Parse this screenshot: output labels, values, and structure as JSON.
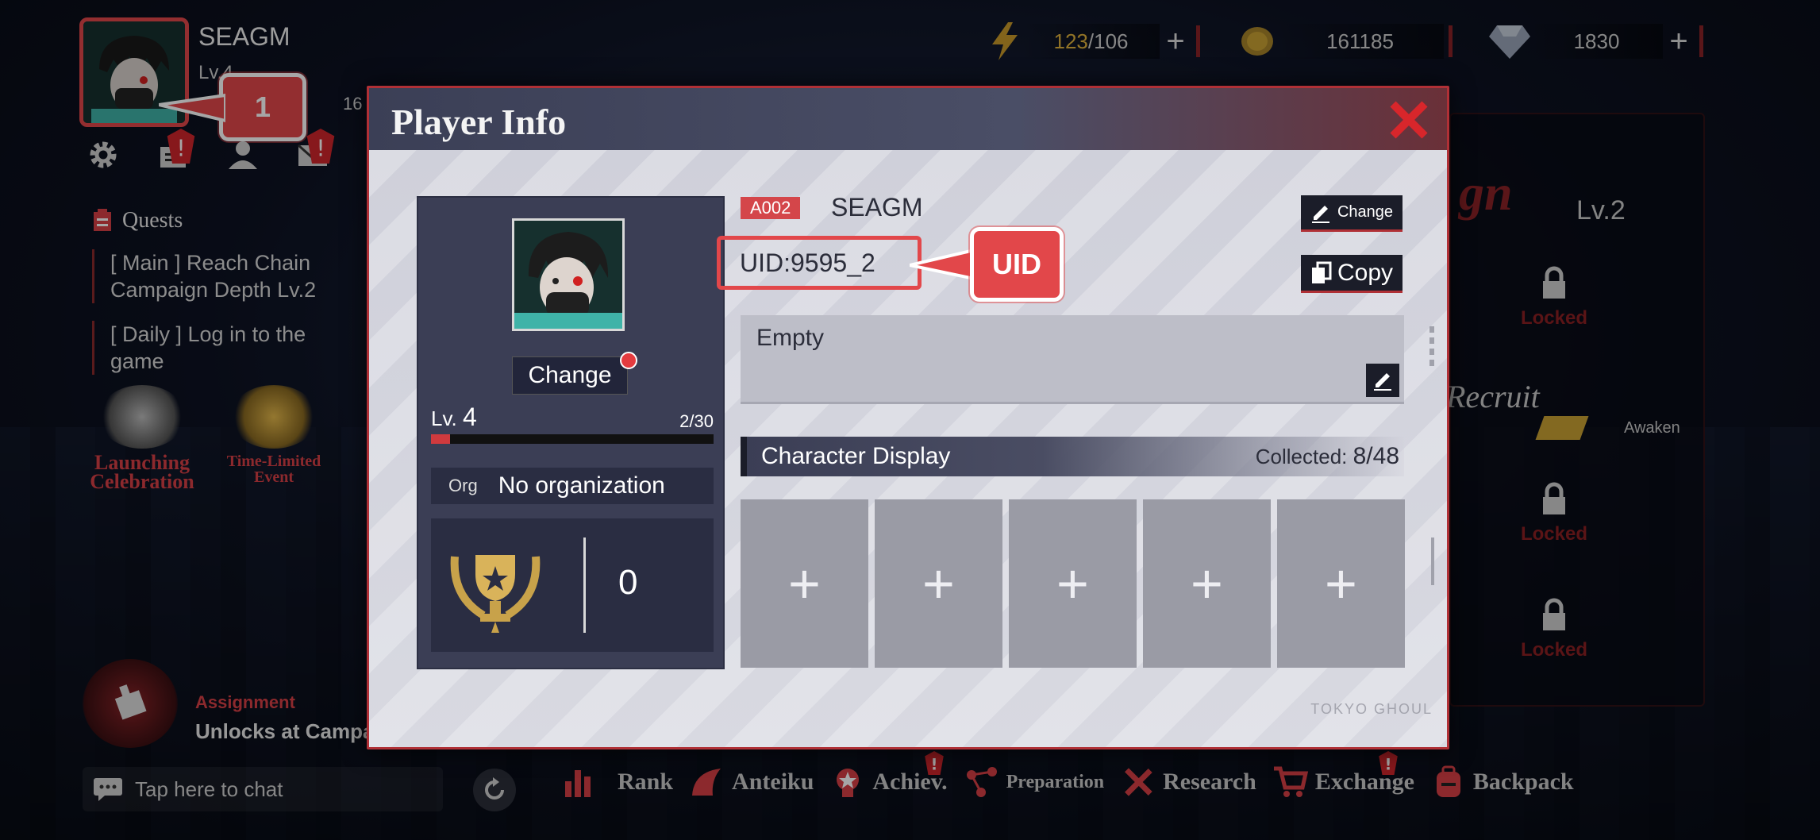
{
  "hud": {
    "player_name": "SEAGM",
    "level_short": "Lv.4",
    "stat_16": "16"
  },
  "callouts": {
    "step_1": "1",
    "uid": "UID"
  },
  "resources": {
    "energy_current": "123",
    "energy_max": "/106",
    "gold": "161185",
    "gems": "1830"
  },
  "quests": {
    "title": "Quests",
    "items": [
      {
        "line1": "[ Main ]   Reach Chain",
        "line2": "Campaign Depth Lv.2"
      },
      {
        "line1": "[ Daily ]    Log in to the",
        "line2": "game"
      }
    ]
  },
  "events": [
    {
      "label_1": "Launching",
      "label_2": "Celebration"
    },
    {
      "label_1": "Time-Limited",
      "label_2": "Event"
    }
  ],
  "assignment": {
    "title": "Assignment",
    "subtitle": "Unlocks at Campa"
  },
  "chat": {
    "placeholder": "Tap here to chat"
  },
  "bottom_nav": {
    "items": [
      {
        "label": "Rank"
      },
      {
        "label": "Anteiku"
      },
      {
        "label": "Achiev."
      },
      {
        "label": "Preparation"
      },
      {
        "label": "Research"
      },
      {
        "label": "Exchange"
      },
      {
        "label": "Backpack"
      }
    ]
  },
  "right_panel": {
    "campaign": "gn",
    "level": "Lv.2",
    "locked_label": "Locked",
    "recruit": "Recruit",
    "awaken": "Awaken"
  },
  "modal": {
    "title": "Player Info",
    "watermark": "TOKYO GHOUL",
    "card": {
      "change_label": "Change",
      "level_label": "Lv.",
      "level_value": "4",
      "xp_text": "2/30",
      "xp_progress": 0.067,
      "org_label": "Org",
      "org_value": "No organization",
      "trophy_count": "0"
    },
    "info": {
      "id_tag": "A002",
      "name": "SEAGM",
      "uid": "UID:9595_2",
      "change_name_label": "Change",
      "copy_label": "Copy",
      "bio": "Empty"
    },
    "character_display": {
      "title": "Character Display",
      "collected_label": "Collected: ",
      "collected_value": "8/48",
      "slot_symbol": "+"
    }
  },
  "colors": {
    "accent_red": "#e2474a",
    "modal_bg": "#dadbe3",
    "card_bg": "#3b3e55",
    "gold_energy": "#e0b33d"
  }
}
